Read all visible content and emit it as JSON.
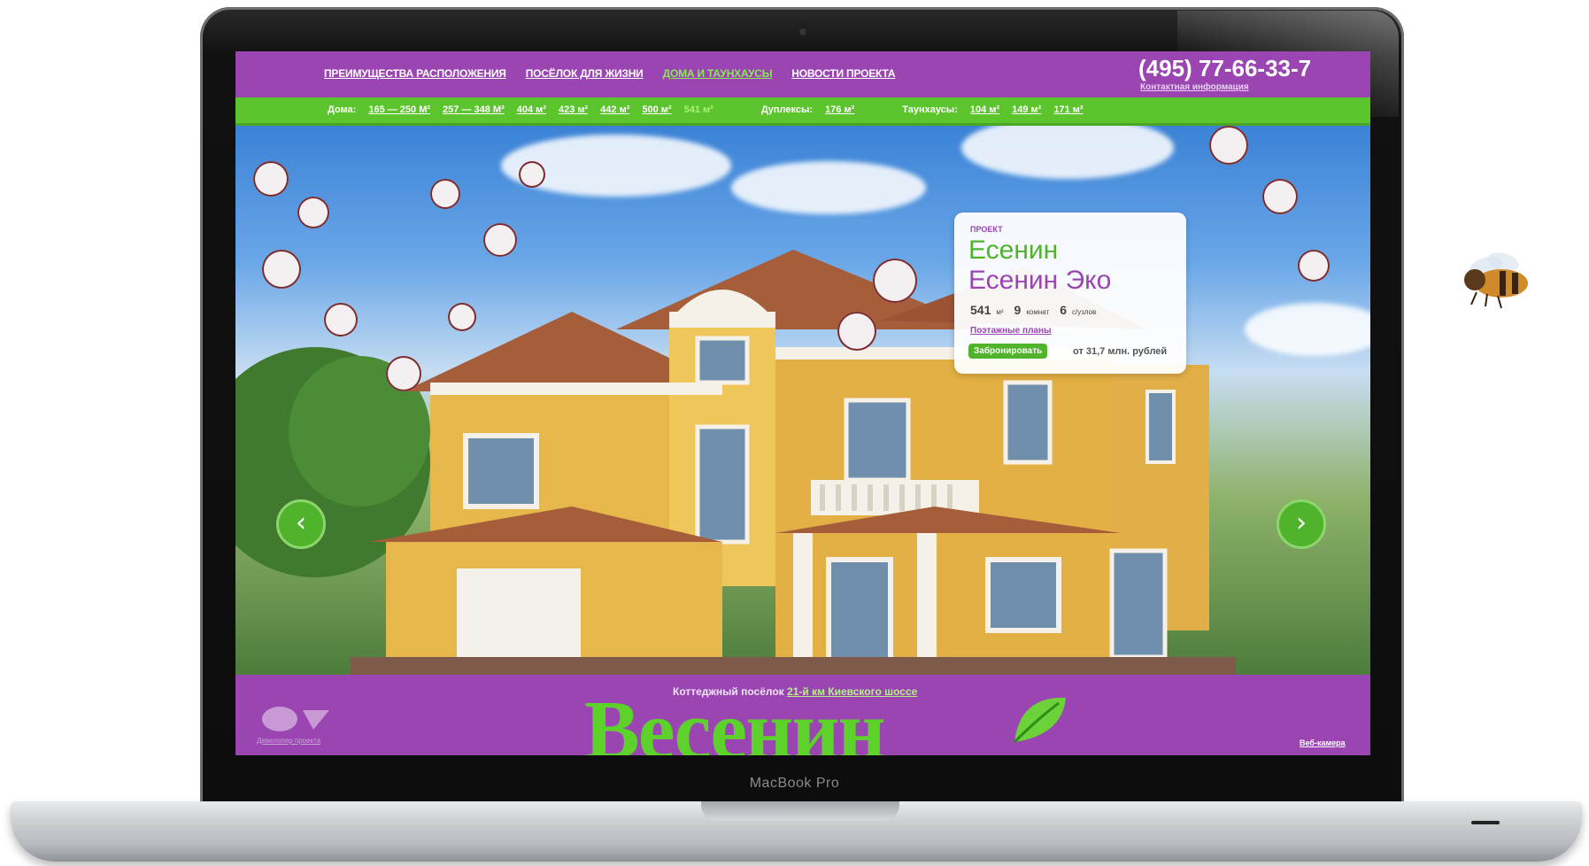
{
  "device": {
    "brand": "MacBook Pro"
  },
  "header": {
    "nav": [
      {
        "label": "Преимущества расположения",
        "active": false
      },
      {
        "label": "Посёлок для жизни",
        "active": false
      },
      {
        "label": "Дома и таунхаусы",
        "active": true
      },
      {
        "label": "Новости проекта",
        "active": false
      }
    ],
    "phone": "(495) 77-66-33-7",
    "contact_link": "Контактная информация"
  },
  "subnav": {
    "houses_label": "Дома:",
    "houses": [
      "165 — 250 М²",
      "257 — 348 М²",
      "404 м²",
      "423 м²",
      "442 м²",
      "500 м²",
      "541 м²"
    ],
    "houses_selected": "541 м²",
    "duplex_label": "Дуплексы:",
    "duplex": [
      "176 м²"
    ],
    "townhouse_label": "Таунхаусы:",
    "townhouses": [
      "104 м²",
      "149 м²",
      "171 м²"
    ]
  },
  "slide": {
    "kicker": "проект",
    "title_1": "Есенин",
    "title_2": "Есенин Эко",
    "area": "541",
    "area_unit": "м²",
    "rooms": "9",
    "rooms_unit": "комнат",
    "bathrooms": "6",
    "bathrooms_unit": "с/узлов",
    "plans_link": "Поэтажные планы",
    "book_button": "Забронировать",
    "price": "от 31,7 млн. рублей",
    "prev_arrow": "‹",
    "next_arrow": "›"
  },
  "footer": {
    "subtitle_pre": "Коттеджный посёлок",
    "subtitle_road": "21-й км Киевского шоссе",
    "logo": "Весенин",
    "partner_label": "Девелопер проекта",
    "camera_link": "Веб-камера"
  },
  "colors": {
    "purple": "#9b45b3",
    "green": "#5cc42c",
    "accent_green": "#4fb32c"
  }
}
